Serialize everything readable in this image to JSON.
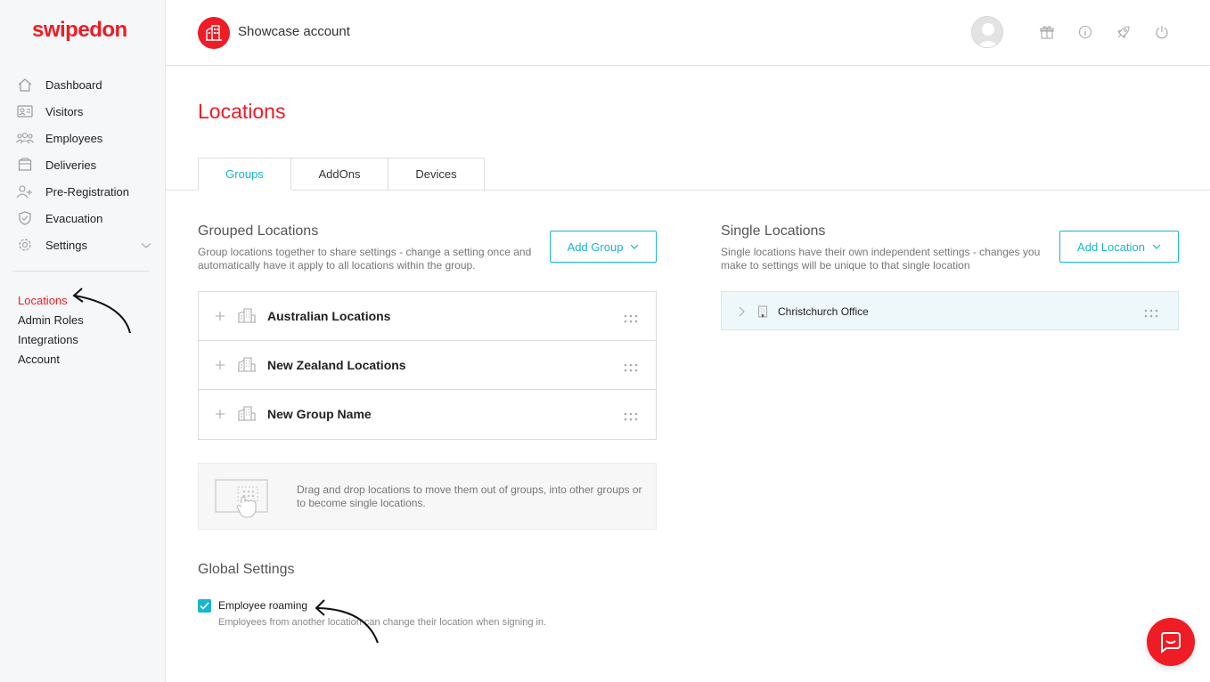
{
  "brand": {
    "name": "swipedon"
  },
  "sidebar": {
    "items": [
      {
        "label": "Dashboard",
        "icon": "home-icon"
      },
      {
        "label": "Visitors",
        "icon": "id-card-icon"
      },
      {
        "label": "Employees",
        "icon": "people-icon"
      },
      {
        "label": "Deliveries",
        "icon": "box-icon"
      },
      {
        "label": "Pre-Registration",
        "icon": "add-user-icon"
      },
      {
        "label": "Evacuation",
        "icon": "shield-icon"
      },
      {
        "label": "Settings",
        "icon": "gear-icon"
      }
    ],
    "sub_items": [
      {
        "label": "Locations",
        "active": true
      },
      {
        "label": "Admin Roles"
      },
      {
        "label": "Integrations"
      },
      {
        "label": "Account"
      }
    ]
  },
  "header": {
    "account_name": "Showcase account",
    "icons": [
      "gift-icon",
      "info-icon",
      "rocket-icon",
      "power-icon"
    ]
  },
  "page": {
    "title": "Locations",
    "tabs": [
      {
        "label": "Groups",
        "active": true
      },
      {
        "label": "AddOns"
      },
      {
        "label": "Devices"
      }
    ]
  },
  "grouped": {
    "title": "Grouped Locations",
    "description": "Group locations together to share settings - change a setting once and automatically have it apply to all locations within the group.",
    "add_button": "Add Group",
    "groups": [
      {
        "name": "Australian Locations"
      },
      {
        "name": "New Zealand Locations"
      },
      {
        "name": "New Group Name"
      }
    ],
    "drag_hint": "Drag and drop locations to move them out of groups, into other groups or to become single locations."
  },
  "single": {
    "title": "Single Locations",
    "description": "Single locations have their own independent settings - changes you make to settings will be unique to that single location",
    "add_button": "Add Location",
    "locations": [
      {
        "name": "Christchurch Office"
      }
    ]
  },
  "global": {
    "title": "Global Settings",
    "roaming_label": "Employee roaming",
    "roaming_checked": true,
    "roaming_desc": "Employees from another location can change their location when signing in."
  },
  "colors": {
    "brand": "#ee1c25",
    "accent": "#1ab5d1"
  }
}
